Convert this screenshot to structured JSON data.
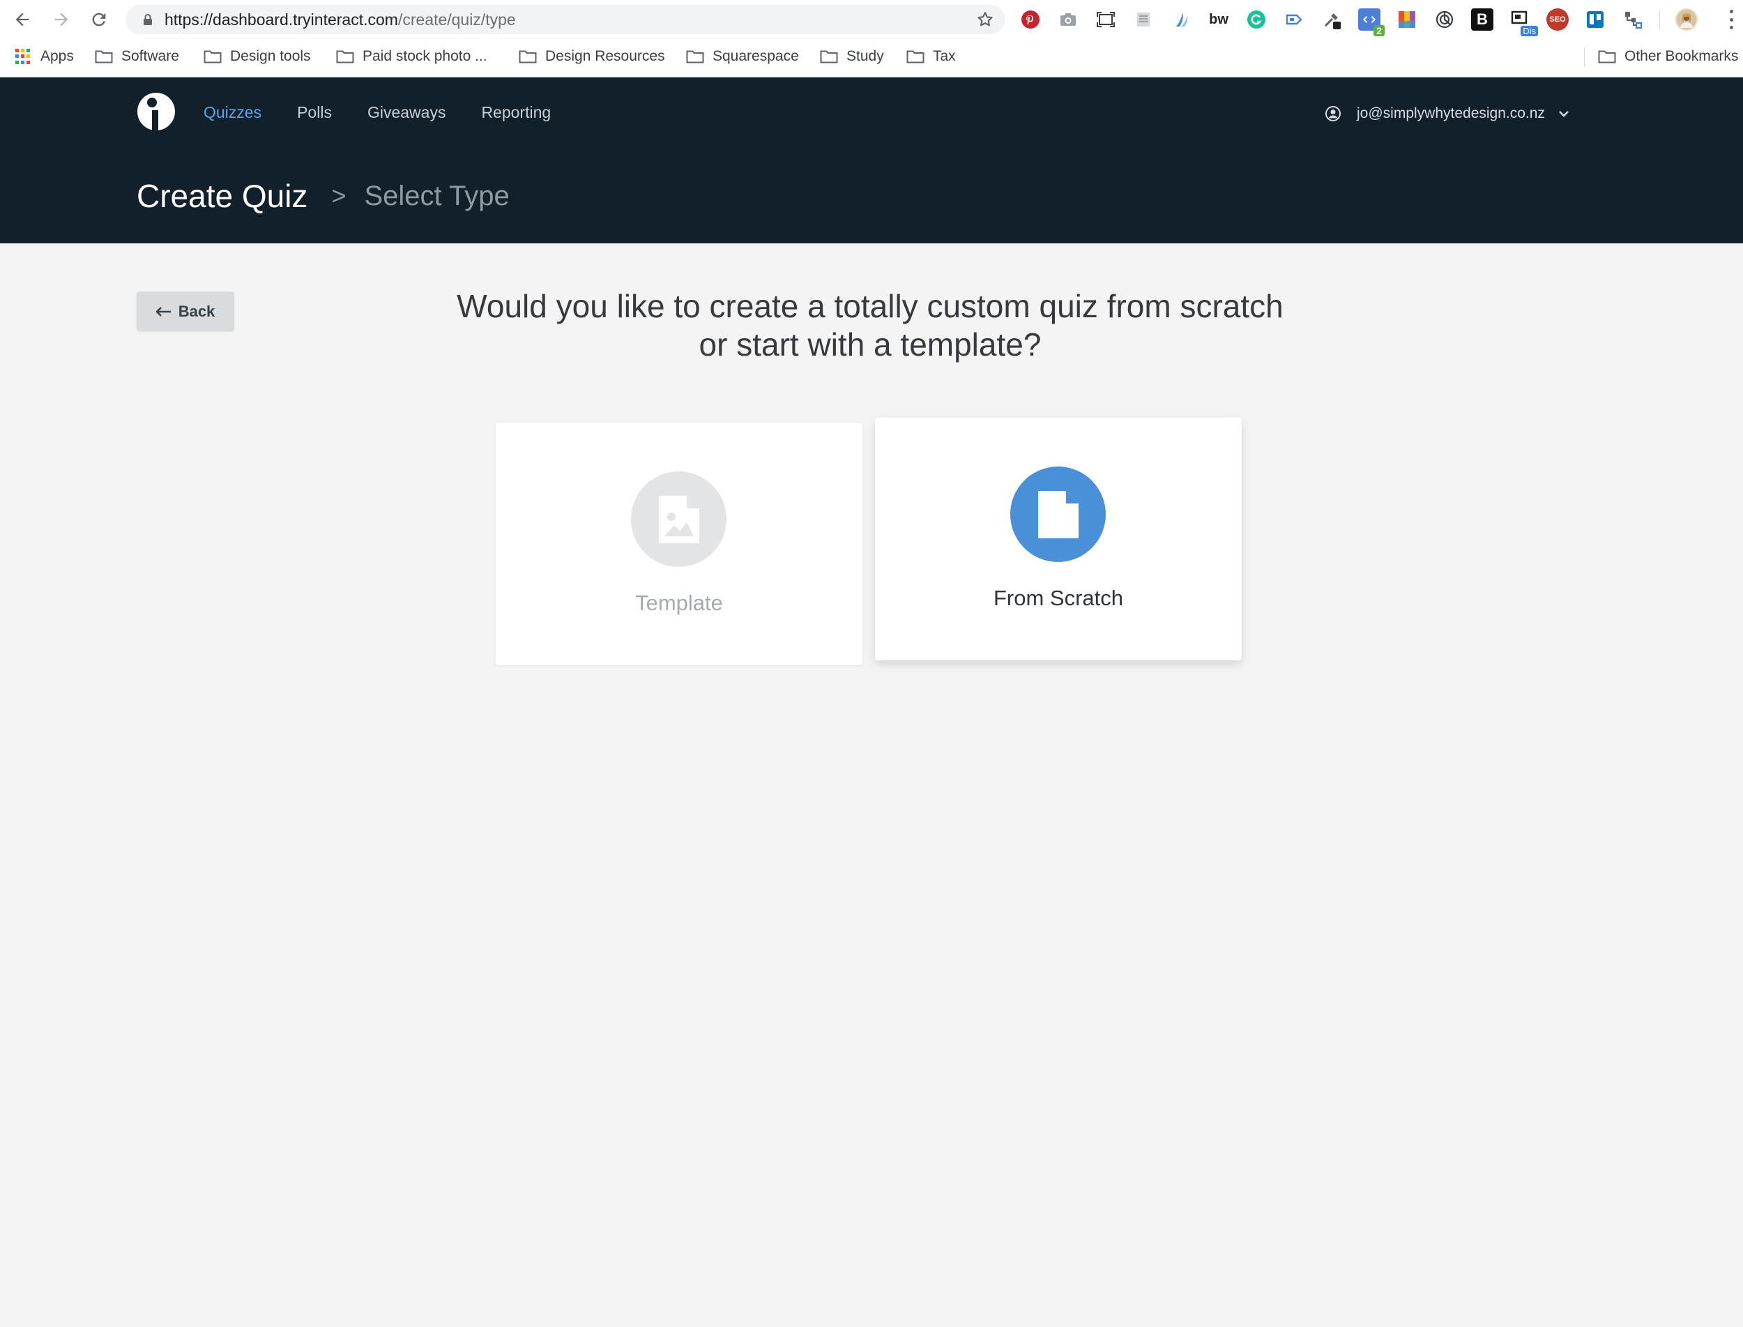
{
  "browser": {
    "url_host": "https://dashboard.tryinteract.com",
    "url_path": "/create/quiz/type",
    "extension_badges": {
      "code": "2",
      "dis": "Dis",
      "seo": "SEO",
      "b": "B",
      "bw": "bw"
    },
    "bookmarks": [
      {
        "label": "Apps",
        "icon": "apps-grid-icon"
      },
      {
        "label": "Software",
        "icon": "folder-icon"
      },
      {
        "label": "Design tools",
        "icon": "folder-icon"
      },
      {
        "label": "Paid stock photo ...",
        "icon": "folder-icon"
      },
      {
        "label": "Design Resources",
        "icon": "folder-icon"
      },
      {
        "label": "Squarespace",
        "icon": "folder-icon"
      },
      {
        "label": "Study",
        "icon": "folder-icon"
      },
      {
        "label": "Tax",
        "icon": "folder-icon"
      }
    ],
    "other_bookmarks": "Other Bookmarks"
  },
  "app": {
    "nav": [
      {
        "label": "Quizzes",
        "active": true
      },
      {
        "label": "Polls",
        "active": false
      },
      {
        "label": "Giveaways",
        "active": false
      },
      {
        "label": "Reporting",
        "active": false
      }
    ],
    "user_email": "jo@simplywhytedesign.co.nz",
    "breadcrumb": {
      "main": "Create Quiz",
      "separator": ">",
      "current": "Select Type"
    }
  },
  "main": {
    "back_label": "Back",
    "question_line1": "Would you like to create a totally custom quiz from scratch",
    "question_line2": "or start with a template?",
    "options": [
      {
        "label": "Template",
        "icon": "image-file-icon"
      },
      {
        "label": "From Scratch",
        "icon": "blank-file-icon"
      }
    ]
  },
  "colors": {
    "header_bg": "#12202b",
    "nav_active": "#57a6ec",
    "accent_blue": "#4a90d9",
    "page_bg": "#f3f4f3"
  }
}
